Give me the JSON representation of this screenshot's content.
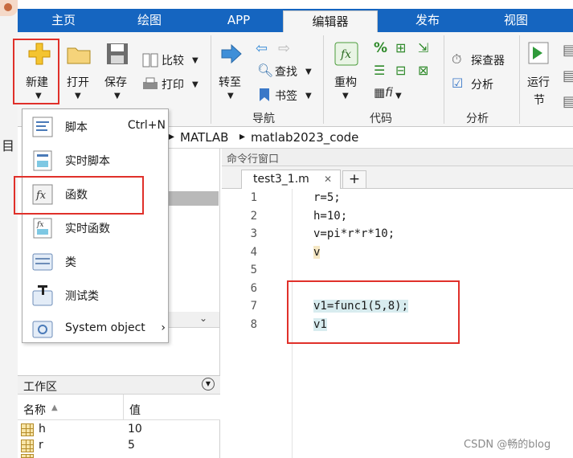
{
  "ribbon_tabs": [
    "主页",
    "绘图",
    "APP",
    "编辑器",
    "发布",
    "视图"
  ],
  "ribbon": {
    "new_label": "新建",
    "open_label": "打开",
    "save_label": "保存",
    "compare_label": "比较",
    "print_label": "打印",
    "goto_label": "转至",
    "find_label": "查找",
    "bookmark_label": "书签",
    "refactor_label": "重构",
    "profiler_label": "探查器",
    "analyze_label": "分析",
    "run_label_1": "运行",
    "run_label_2": "节",
    "group_nav": "导航",
    "group_code": "代码",
    "group_analysis": "分析"
  },
  "path": {
    "sep1": "▸",
    "part1": "MATLAB",
    "sep2": "▸",
    "part2": "matlab2023_code"
  },
  "cmd_window_label": "命令行窗口",
  "editor": {
    "file_tab": "test3_1.m",
    "close_glyph": "✕",
    "add_glyph": "+",
    "line_numbers": [
      "1",
      "2",
      "3",
      "4",
      "5",
      "6",
      "7",
      "8"
    ],
    "lines": [
      "r=5;",
      "h=10;",
      "v=pi*r*r*10;",
      "v",
      "",
      "",
      "v1=func1(5,8);",
      "v1"
    ]
  },
  "new_menu": [
    {
      "label": "脚本",
      "shortcut": "Ctrl+N"
    },
    {
      "label": "实时脚本",
      "shortcut": ""
    },
    {
      "label": "函数",
      "shortcut": ""
    },
    {
      "label": "实时函数",
      "shortcut": ""
    },
    {
      "label": "类",
      "shortcut": ""
    },
    {
      "label": "测试类",
      "shortcut": ""
    },
    {
      "label": "System object",
      "shortcut": "›"
    }
  ],
  "workspace": {
    "title": "工作区",
    "col_name": "名称",
    "col_value": "值",
    "rows": [
      {
        "name": "h",
        "value": "10"
      },
      {
        "name": "r",
        "value": "5"
      }
    ]
  },
  "left_glyph": "目",
  "watermark": "CSDN @畅的blog",
  "colors": {
    "tab_blue": "#1565c0",
    "callout_red": "#e0302a",
    "highlight": "#d8ecef"
  }
}
